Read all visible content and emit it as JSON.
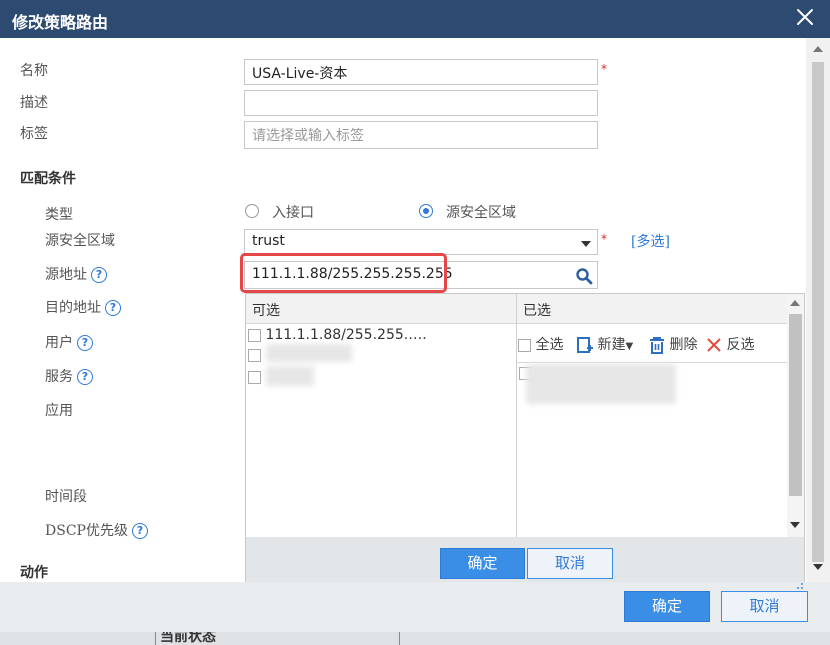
{
  "dialog": {
    "title": "修改策略路由"
  },
  "form": {
    "name_label": "名称",
    "name_value": "USA-Live-资本",
    "desc_label": "描述",
    "desc_value": "",
    "tag_label": "标签",
    "tag_placeholder": "请选择或输入标签",
    "match_section": "匹配条件",
    "type_label": "类型",
    "type_options": [
      "入接口",
      "源安全区域"
    ],
    "type_selected": "源安全区域",
    "src_zone_label": "源安全区域",
    "src_zone_value": "trust",
    "multi_select_link": "[多选]",
    "src_addr_label": "源地址",
    "src_addr_value": "111.1.1.88/255.255.255.255",
    "dst_addr_label": "目的地址",
    "user_label": "用户",
    "service_label": "服务",
    "app_label": "应用",
    "time_label": "时间段",
    "dscp_label": "DSCP优先级",
    "action_section": "动作",
    "required_mark": "*",
    "help_mark": "?"
  },
  "picker": {
    "available_header": "可选",
    "selected_header": "已选",
    "available_items": [
      "111.1.1.88/255.255.…."
    ],
    "select_all": "全选",
    "new_label": "新建",
    "delete_label": "删除",
    "invert_label": "反选",
    "confirm_label": "确定",
    "cancel_label": "取消"
  },
  "footer": {
    "confirm_label": "确定",
    "cancel_label": "取消"
  },
  "background": {
    "current_status": "当前状态"
  },
  "colors": {
    "title_bar": "#2d4a70",
    "accent": "#3a8ee6",
    "highlight_box": "#e54646",
    "required": "#d62b2b"
  }
}
